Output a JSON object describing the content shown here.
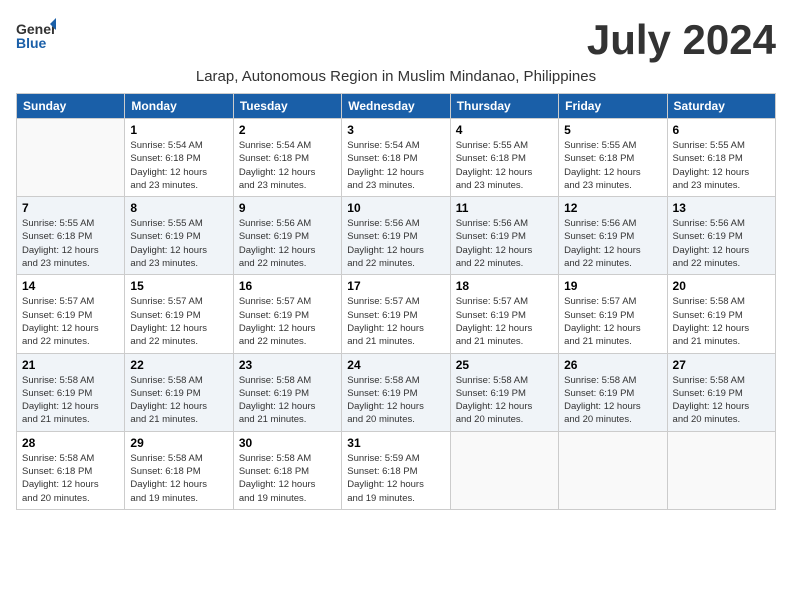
{
  "header": {
    "logo_general": "General",
    "logo_blue": "Blue",
    "month_title": "July 2024",
    "subtitle": "Larap, Autonomous Region in Muslim Mindanao, Philippines"
  },
  "days_of_week": [
    "Sunday",
    "Monday",
    "Tuesday",
    "Wednesday",
    "Thursday",
    "Friday",
    "Saturday"
  ],
  "weeks": [
    [
      {
        "day": "",
        "info": ""
      },
      {
        "day": "1",
        "info": "Sunrise: 5:54 AM\nSunset: 6:18 PM\nDaylight: 12 hours\nand 23 minutes."
      },
      {
        "day": "2",
        "info": "Sunrise: 5:54 AM\nSunset: 6:18 PM\nDaylight: 12 hours\nand 23 minutes."
      },
      {
        "day": "3",
        "info": "Sunrise: 5:54 AM\nSunset: 6:18 PM\nDaylight: 12 hours\nand 23 minutes."
      },
      {
        "day": "4",
        "info": "Sunrise: 5:55 AM\nSunset: 6:18 PM\nDaylight: 12 hours\nand 23 minutes."
      },
      {
        "day": "5",
        "info": "Sunrise: 5:55 AM\nSunset: 6:18 PM\nDaylight: 12 hours\nand 23 minutes."
      },
      {
        "day": "6",
        "info": "Sunrise: 5:55 AM\nSunset: 6:18 PM\nDaylight: 12 hours\nand 23 minutes."
      }
    ],
    [
      {
        "day": "7",
        "info": "Sunrise: 5:55 AM\nSunset: 6:18 PM\nDaylight: 12 hours\nand 23 minutes."
      },
      {
        "day": "8",
        "info": "Sunrise: 5:55 AM\nSunset: 6:19 PM\nDaylight: 12 hours\nand 23 minutes."
      },
      {
        "day": "9",
        "info": "Sunrise: 5:56 AM\nSunset: 6:19 PM\nDaylight: 12 hours\nand 22 minutes."
      },
      {
        "day": "10",
        "info": "Sunrise: 5:56 AM\nSunset: 6:19 PM\nDaylight: 12 hours\nand 22 minutes."
      },
      {
        "day": "11",
        "info": "Sunrise: 5:56 AM\nSunset: 6:19 PM\nDaylight: 12 hours\nand 22 minutes."
      },
      {
        "day": "12",
        "info": "Sunrise: 5:56 AM\nSunset: 6:19 PM\nDaylight: 12 hours\nand 22 minutes."
      },
      {
        "day": "13",
        "info": "Sunrise: 5:56 AM\nSunset: 6:19 PM\nDaylight: 12 hours\nand 22 minutes."
      }
    ],
    [
      {
        "day": "14",
        "info": "Sunrise: 5:57 AM\nSunset: 6:19 PM\nDaylight: 12 hours\nand 22 minutes."
      },
      {
        "day": "15",
        "info": "Sunrise: 5:57 AM\nSunset: 6:19 PM\nDaylight: 12 hours\nand 22 minutes."
      },
      {
        "day": "16",
        "info": "Sunrise: 5:57 AM\nSunset: 6:19 PM\nDaylight: 12 hours\nand 22 minutes."
      },
      {
        "day": "17",
        "info": "Sunrise: 5:57 AM\nSunset: 6:19 PM\nDaylight: 12 hours\nand 21 minutes."
      },
      {
        "day": "18",
        "info": "Sunrise: 5:57 AM\nSunset: 6:19 PM\nDaylight: 12 hours\nand 21 minutes."
      },
      {
        "day": "19",
        "info": "Sunrise: 5:57 AM\nSunset: 6:19 PM\nDaylight: 12 hours\nand 21 minutes."
      },
      {
        "day": "20",
        "info": "Sunrise: 5:58 AM\nSunset: 6:19 PM\nDaylight: 12 hours\nand 21 minutes."
      }
    ],
    [
      {
        "day": "21",
        "info": "Sunrise: 5:58 AM\nSunset: 6:19 PM\nDaylight: 12 hours\nand 21 minutes."
      },
      {
        "day": "22",
        "info": "Sunrise: 5:58 AM\nSunset: 6:19 PM\nDaylight: 12 hours\nand 21 minutes."
      },
      {
        "day": "23",
        "info": "Sunrise: 5:58 AM\nSunset: 6:19 PM\nDaylight: 12 hours\nand 21 minutes."
      },
      {
        "day": "24",
        "info": "Sunrise: 5:58 AM\nSunset: 6:19 PM\nDaylight: 12 hours\nand 20 minutes."
      },
      {
        "day": "25",
        "info": "Sunrise: 5:58 AM\nSunset: 6:19 PM\nDaylight: 12 hours\nand 20 minutes."
      },
      {
        "day": "26",
        "info": "Sunrise: 5:58 AM\nSunset: 6:19 PM\nDaylight: 12 hours\nand 20 minutes."
      },
      {
        "day": "27",
        "info": "Sunrise: 5:58 AM\nSunset: 6:19 PM\nDaylight: 12 hours\nand 20 minutes."
      }
    ],
    [
      {
        "day": "28",
        "info": "Sunrise: 5:58 AM\nSunset: 6:18 PM\nDaylight: 12 hours\nand 20 minutes."
      },
      {
        "day": "29",
        "info": "Sunrise: 5:58 AM\nSunset: 6:18 PM\nDaylight: 12 hours\nand 19 minutes."
      },
      {
        "day": "30",
        "info": "Sunrise: 5:58 AM\nSunset: 6:18 PM\nDaylight: 12 hours\nand 19 minutes."
      },
      {
        "day": "31",
        "info": "Sunrise: 5:59 AM\nSunset: 6:18 PM\nDaylight: 12 hours\nand 19 minutes."
      },
      {
        "day": "",
        "info": ""
      },
      {
        "day": "",
        "info": ""
      },
      {
        "day": "",
        "info": ""
      }
    ]
  ]
}
